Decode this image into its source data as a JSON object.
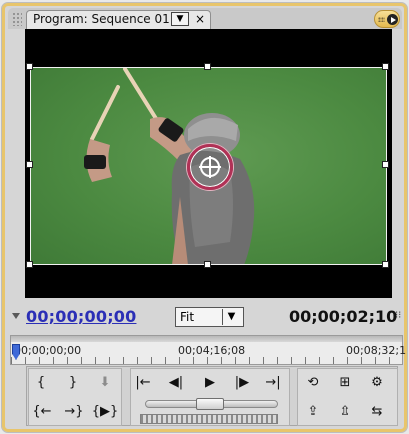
{
  "panel": {
    "tab_label": "Program: Sequence 01",
    "tab_menu_glyph": "▼",
    "tab_close_glyph": "×"
  },
  "timecode": {
    "current": "00;00;00;00",
    "duration": "00;00;02;10"
  },
  "zoom": {
    "selected": "Fit",
    "arrow": "▼"
  },
  "ruler": {
    "labels": [
      "00;00;00;00",
      "00;04;16;08",
      "00;08;32;1"
    ]
  },
  "controls": {
    "mark_in": "{",
    "mark_out": "}",
    "set_marker": "⬇",
    "go_to_in": "{←",
    "go_to_out": "→}",
    "play_in_to_out": "{▶}",
    "go_to_previous_edit": "|←",
    "step_back": "◀|",
    "play": "▶",
    "step_forward": "|▶",
    "go_to_next_edit": "→|",
    "loop": "⟲",
    "safe_margins": "⊞",
    "output": "⚙",
    "lift": "⇪",
    "extract": "⇫",
    "export_frame": "⇆"
  },
  "icons": {
    "panel_grip": "grip-icon",
    "panel_menu": "panel-menu-icon",
    "anchor": "anchor-point-icon",
    "timecode_expand": "triangle-down-icon",
    "ruler_end": "ruler-end-icon"
  },
  "colors": {
    "accent_frame": "#e8c56b",
    "timecode_current": "#2b2fb6",
    "anchor_ring": "#b13156",
    "green_screen": "#4c8a41"
  },
  "playback": {
    "playhead_fraction": 0
  }
}
